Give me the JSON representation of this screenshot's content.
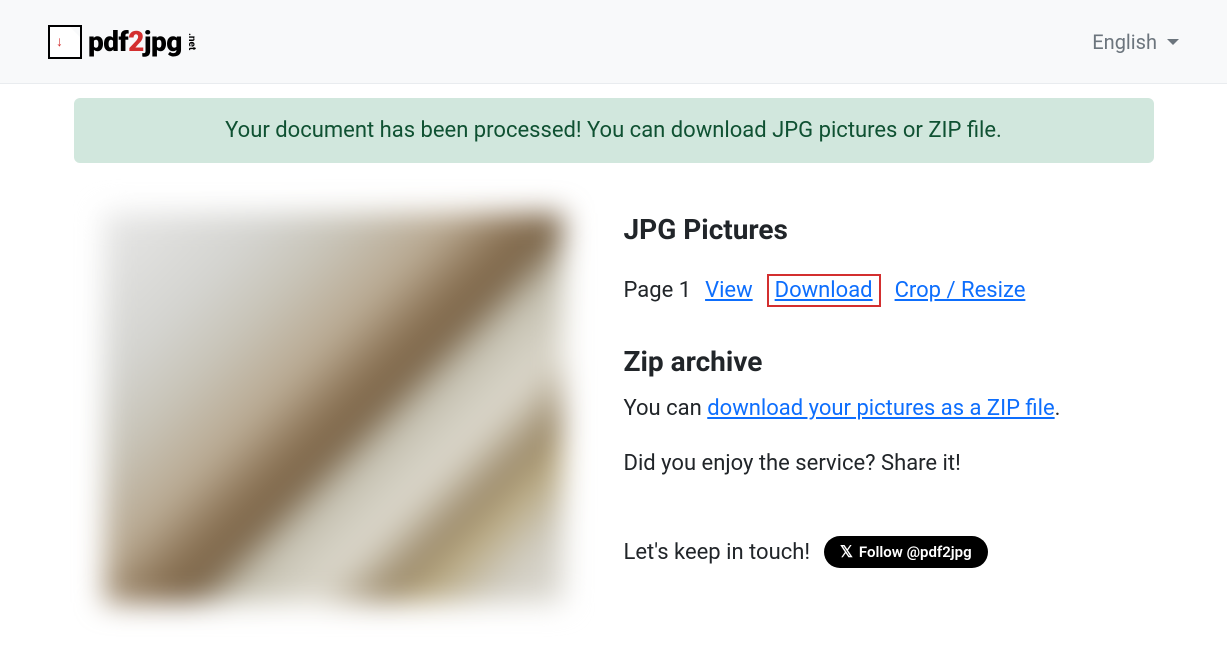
{
  "header": {
    "logo_pdf": "pdf",
    "logo_two": "2",
    "logo_jpg": "jpg",
    "logo_net": ".net",
    "language": "English"
  },
  "alert": {
    "message": "Your document has been processed! You can download JPG pictures or ZIP file."
  },
  "jpg": {
    "heading": "JPG Pictures",
    "page_label": "Page 1",
    "view": "View",
    "download": "Download",
    "crop": "Crop / Resize"
  },
  "zip": {
    "heading": "Zip archive",
    "prefix": "You can ",
    "link": "download your pictures as a ZIP file",
    "suffix": "."
  },
  "share": {
    "text": "Did you enjoy the service? Share it!"
  },
  "touch": {
    "text": "Let's keep in touch!",
    "follow": "Follow @pdf2jpg"
  }
}
